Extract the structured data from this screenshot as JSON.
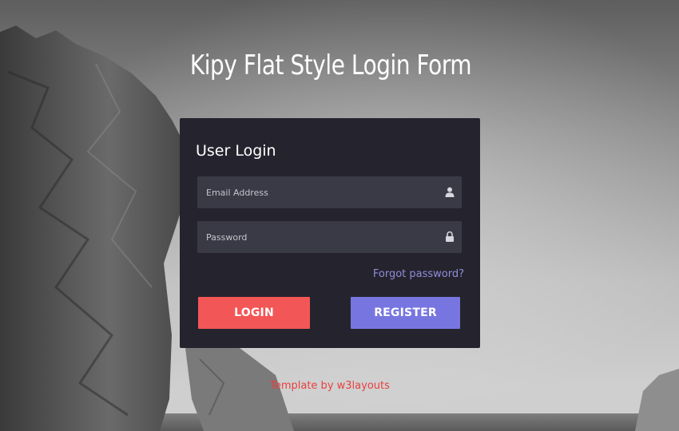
{
  "page": {
    "title": "Kipy Flat Style Login Form",
    "footer": "Template by w3layouts"
  },
  "login_form": {
    "heading": "User Login",
    "email": {
      "placeholder": "Email Address",
      "value": "",
      "icon": "user-icon"
    },
    "password": {
      "placeholder": "Password",
      "value": "",
      "icon": "lock-icon"
    },
    "forgot_label": "Forgot password?",
    "login_label": "LOGIN",
    "register_label": "REGISTER"
  },
  "colors": {
    "panel_bg": "#25242e",
    "field_bg": "#3a3946",
    "login_button": "#f35656",
    "register_button": "#7776e0",
    "forgot_link": "#8f8cd9",
    "footer_text": "#e8403f"
  }
}
